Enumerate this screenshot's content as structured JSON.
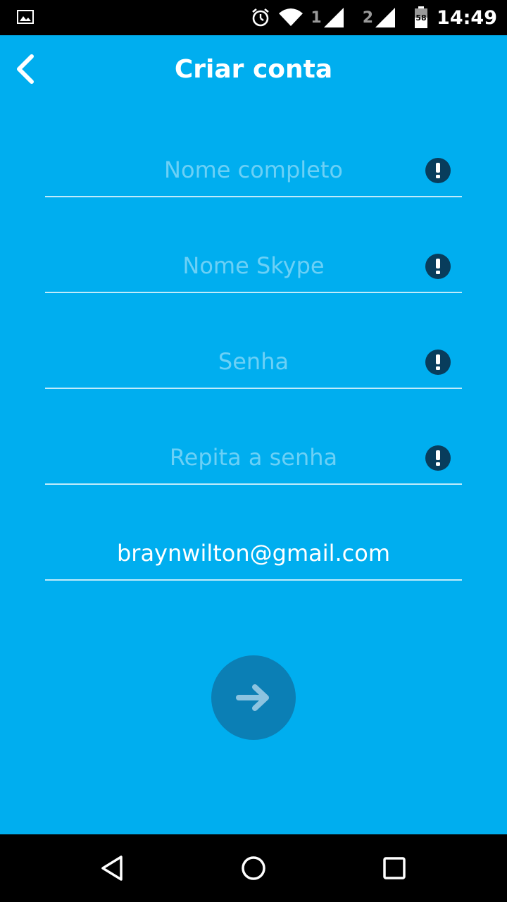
{
  "status_bar": {
    "sim1": "1",
    "sim2": "2",
    "battery_level": "58",
    "time": "14:49"
  },
  "header": {
    "title": "Criar conta"
  },
  "form": {
    "full_name": {
      "placeholder": "Nome completo",
      "value": ""
    },
    "skype_name": {
      "placeholder": "Nome Skype",
      "value": ""
    },
    "password": {
      "placeholder": "Senha",
      "value": ""
    },
    "repeat_password": {
      "placeholder": "Repita a senha",
      "value": ""
    },
    "email": {
      "placeholder": "",
      "value": "braynwilton@gmail.com"
    }
  },
  "icons": {
    "back": "chevron-left-icon",
    "warning": "exclamation-circle-icon",
    "next": "arrow-right-icon",
    "nav_back": "triangle-back-icon",
    "nav_home": "circle-home-icon",
    "nav_recents": "square-recents-icon"
  },
  "colors": {
    "background": "#00aeef",
    "warning_icon": "#083d5c",
    "next_button": "#0b7fb5",
    "bars": "#000000"
  }
}
